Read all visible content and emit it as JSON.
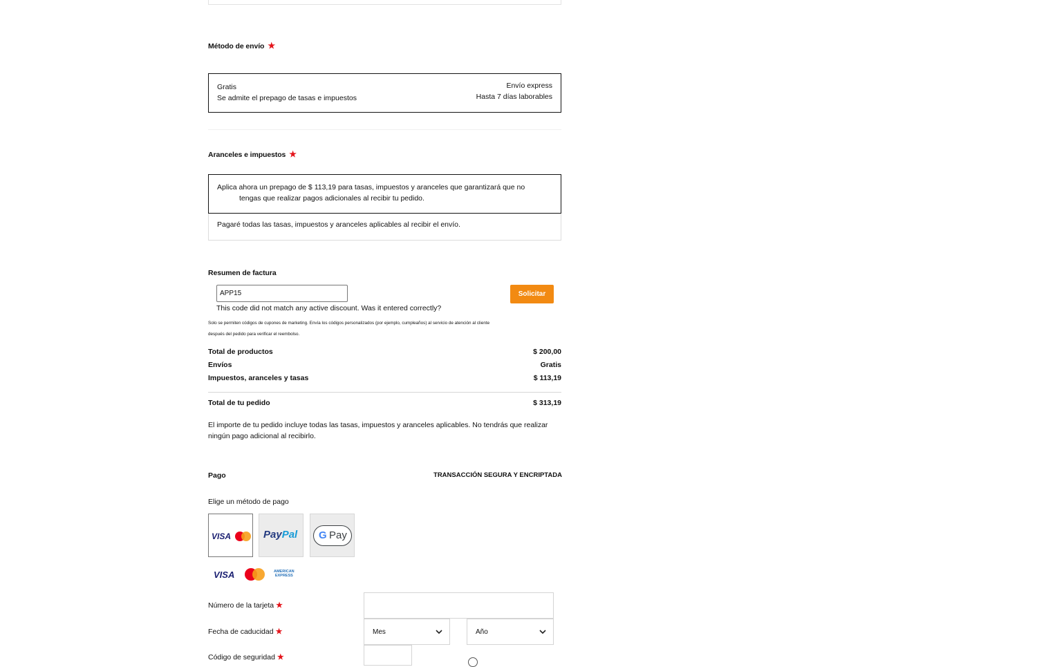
{
  "shipping": {
    "title": "Método de envío",
    "required_mark": "★",
    "option": {
      "name": "Gratis",
      "desc": "Se admite el prepago de tasas e impuestos",
      "type": "Envío express",
      "time": "Hasta 7 días laborables"
    }
  },
  "duties": {
    "title": "Aranceles e impuestos",
    "required_mark": "★",
    "option1_line1": "Aplica ahora un prepago de $ 113,19 para tasas, impuestos y aranceles que garantizará que no",
    "option1_line2": "tengas que realizar pagos adicionales al recibir tu pedido.",
    "option2": "Pagaré todas las tasas, impuestos y aranceles aplicables al recibir el envío."
  },
  "summary": {
    "title": "Resumen de factura",
    "coupon_value": "APP15",
    "apply_label": "Solicitar",
    "error": "This code did not match any active discount. Was it entered correctly?",
    "note_line1": "Solo se permiten códigos de cupones de marketing. Envía los códigos personalizados (por ejemplo, cumpleaños) al servicio de atención al cliente",
    "note_line2": "después del pedido para verificar el reembolso.",
    "rows": [
      {
        "label": "Total de productos",
        "value": "$ 200,00"
      },
      {
        "label": "Envíos",
        "value": "Gratis"
      },
      {
        "label": "Impuestos, aranceles y tasas",
        "value": "$ 113,19"
      }
    ],
    "total_label": "Total de tu pedido",
    "total_value": "$ 313,19",
    "included_line1": "El importe de tu pedido incluye todas las tasas, impuestos y aranceles aplicables. No tendrás que realizar",
    "included_line2": "ningún pago adicional al recibirlo."
  },
  "payment": {
    "title": "Pago",
    "secure": "TRANSACCIÓN SEGURA Y ENCRIPTADA",
    "choose": "Elige un método de pago",
    "visa": "VISA",
    "paypal_1": "Pay",
    "paypal_2": "Pal",
    "gpay_g": "G",
    "gpay_pay": "Pay",
    "amex_1": "AMERICAN",
    "amex_2": "EXPRESS",
    "card_number_label": "Número de la tarjeta",
    "expiry_label": "Fecha de caducidad",
    "month": "Mes",
    "year": "Año",
    "cvv_label": "Código de seguridad",
    "required_mark": "★"
  },
  "colors": {
    "accent": "#f28a12",
    "required": "#e4141b",
    "visa": "#1a1f71",
    "paypal_dark": "#253b80",
    "paypal_light": "#179bd7"
  }
}
